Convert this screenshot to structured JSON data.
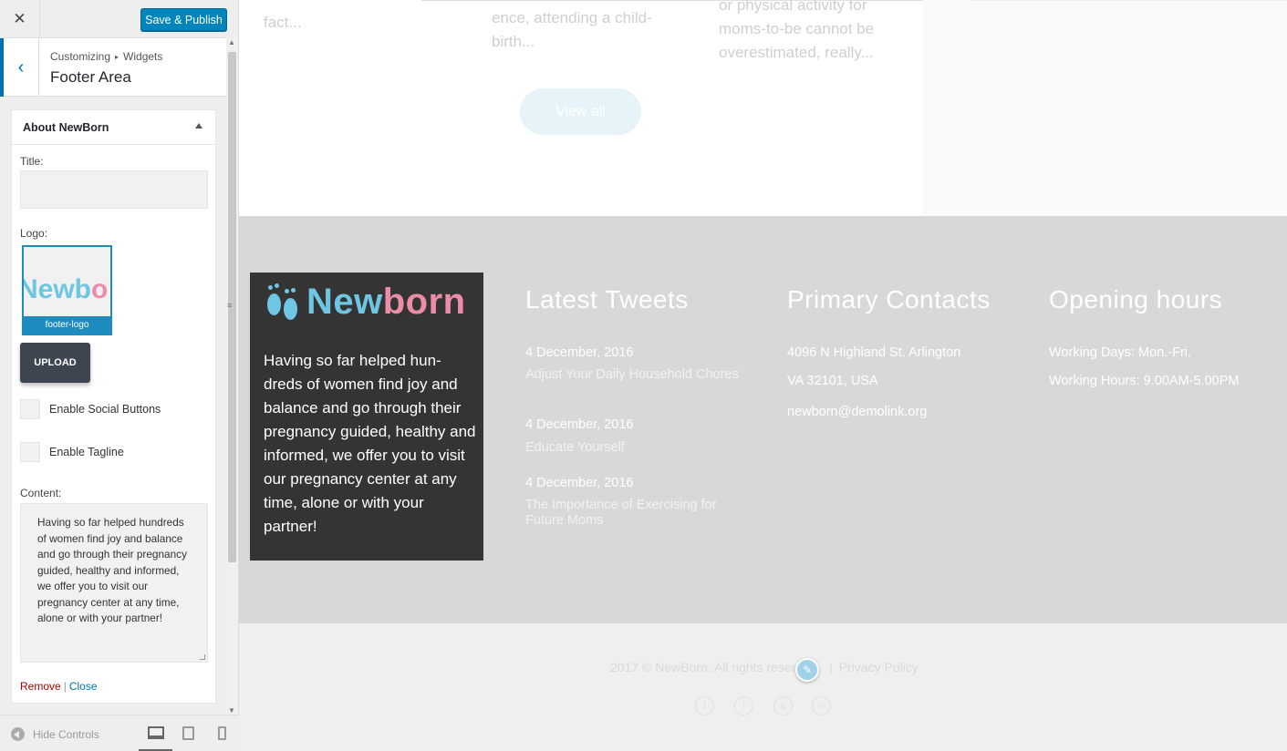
{
  "customizer": {
    "close_glyph": "✕",
    "save_label": "Save & Publish",
    "back_glyph": "‹",
    "breadcrumb": {
      "root": "Customizing",
      "separator": "▸",
      "section": "Widgets"
    },
    "section_title": "Footer Area",
    "widget": {
      "title": "About NewBorn",
      "title_label": "Title:",
      "title_value": "",
      "logo_label": "Logo:",
      "logo_thumb_part1": "Newb",
      "logo_thumb_part2": "o",
      "logo_caption": "footer-logo",
      "upload_label": "UPLOAD",
      "social_label": "Enable Social Buttons",
      "tagline_label": "Enable Tagline",
      "content_label": "Content:",
      "content_value": "Having so far helped hundreds of women find joy and balance and go through their pregnancy guided, healthy and informed, we offer you to visit our pregnancy center at any time, alone or with your partner!",
      "remove_label": "Remove",
      "link_separator": "|",
      "close_label": "Close"
    },
    "footer": {
      "hide_controls": "Hide Controls"
    },
    "colors": {
      "primary": "#0085ba",
      "accent": "#0073aa",
      "danger": "#a00"
    }
  },
  "preview": {
    "excerpts": [
      "fact...",
      "ence, attending a child-birth...",
      "or physical activity for moms-to-be cannot be overestimated, really..."
    ],
    "view_all": "View all",
    "about": {
      "logo_part1": "New",
      "logo_part2": "born",
      "text": "Having so far helped hun-dreds of women find joy and balance and go through their pregnancy guided, healthy and informed, we offer you to visit our pregnancy center at any time, alone or with your partner!"
    },
    "tweets": {
      "title": "Latest Tweets",
      "items": [
        {
          "date": "4 December, 2016",
          "text": "Adjust Your Daily Household Chores"
        },
        {
          "date": "4 December, 2016",
          "text": "Educate Yourself"
        },
        {
          "date": "4 December, 2016",
          "text": "The Importance of Exercising for Future Moms"
        }
      ]
    },
    "contacts": {
      "title": "Primary Contacts",
      "address1": "4096 N Highland St, Arlington",
      "address2": "VA 32101, USA",
      "email": "newborn@demolink.org"
    },
    "hours": {
      "title": "Opening hours",
      "days": "Working Days: Mon.-Fri.",
      "hours": "Working Hours: 9.00AM-5.00PM"
    },
    "bottom": {
      "copyright": "2017 © NewBorn. All rights reser",
      "separator": "|",
      "privacy": "Privacy Policy"
    },
    "colors": {
      "logo_blue": "#6ec6e2",
      "logo_pink": "#ec8da8",
      "footer_bg": "#d8d8d8",
      "about_bg": "#343434"
    }
  }
}
